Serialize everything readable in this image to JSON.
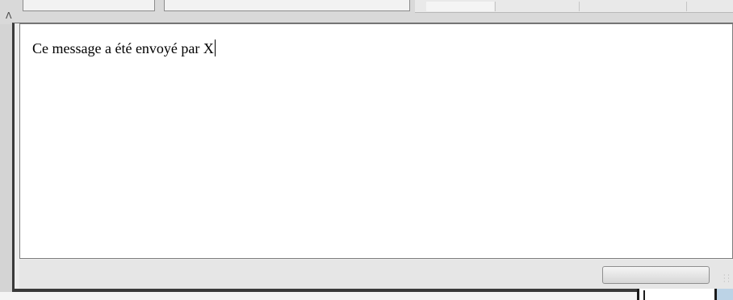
{
  "message_area": {
    "text": "Ce message a été envoyé par X"
  },
  "send_button": {
    "label": ""
  },
  "background": {
    "resize_glyph": "Λ"
  },
  "colors": {
    "window_bg": "#d4d4d4",
    "frame": "#3a3a3a",
    "text_area_bg": "#ffffff",
    "button_gradient_top": "#f5f5f5",
    "button_gradient_bottom": "#d6d6d6"
  },
  "icons": [
    "resize-grip-icon",
    "splitter-arrow-icon"
  ]
}
